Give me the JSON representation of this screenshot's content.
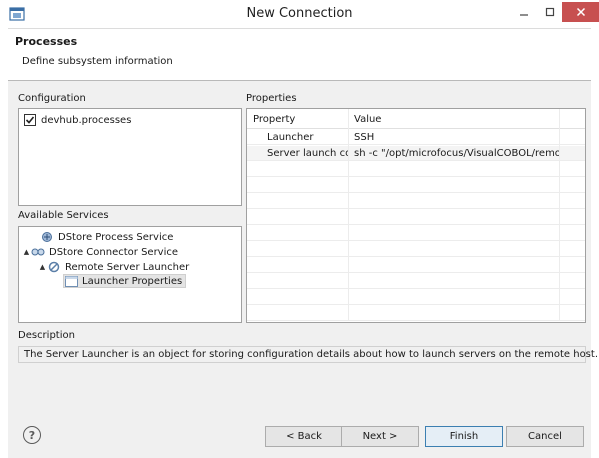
{
  "window": {
    "title": "New Connection",
    "close_color": "#c75050"
  },
  "header": {
    "title": "Processes",
    "description": "Define subsystem information"
  },
  "configuration": {
    "label": "Configuration",
    "items": [
      {
        "label": "devhub.processes",
        "checked": true
      }
    ]
  },
  "services": {
    "label": "Available Services",
    "tree": [
      {
        "label": "DStore Process Service",
        "icon": "process-service-icon",
        "toggle": ""
      },
      {
        "label": "DStore Connector Service",
        "icon": "connector-service-icon",
        "toggle": "▲"
      },
      {
        "label": "Remote Server Launcher",
        "icon": "server-launcher-icon",
        "toggle": "▲"
      },
      {
        "label": "Launcher Properties",
        "icon": "properties-icon",
        "toggle": "",
        "selected": true
      }
    ]
  },
  "properties": {
    "label": "Properties",
    "columns": [
      "Property",
      "Value"
    ],
    "rows": [
      {
        "property": "Launcher",
        "value": "SSH"
      },
      {
        "property": "Server launch com",
        "value": "sh -c \"/opt/microfocus/VisualCOBOL/remo..."
      }
    ]
  },
  "description": {
    "label": "Description",
    "text": "The Server Launcher is an object for storing configuration details about how to launch servers on the remote host."
  },
  "buttons": {
    "back": "< Back",
    "next": "Next >",
    "finish": "Finish",
    "cancel": "Cancel",
    "help": "?"
  }
}
